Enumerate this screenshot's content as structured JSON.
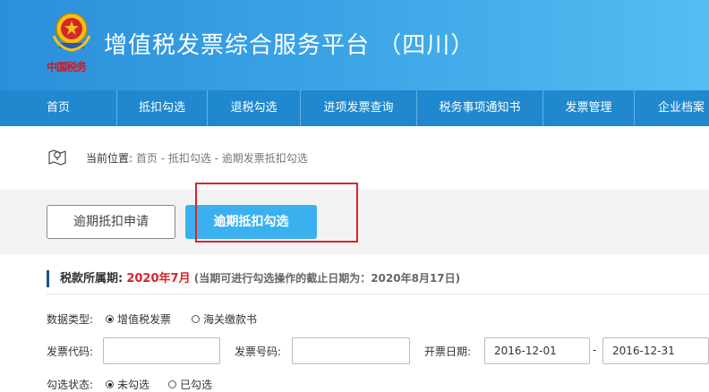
{
  "header": {
    "brand_text": "中国税务",
    "app_title": "增值税发票综合服务平台 （四川）"
  },
  "nav": {
    "items": [
      "首页",
      "抵扣勾选",
      "退税勾选",
      "进项发票查询",
      "税务事项通知书",
      "发票管理",
      "企业档案"
    ]
  },
  "breadcrumb": {
    "prefix": "当前位置:",
    "path": "首页 - 抵扣勾选 - 逾期发票抵扣勾选"
  },
  "tabs": {
    "inactive_label": "逾期抵扣申请",
    "active_label": "逾期抵扣勾选"
  },
  "period": {
    "label": "税款所属期:",
    "value": "2020年7月",
    "note": "(当期可进行勾选操作的截止日期为：2020年8月17日)"
  },
  "form": {
    "data_type_label": "数据类型:",
    "data_type_options": [
      "增值税发票",
      "海关缴款书"
    ],
    "data_type_selected": "增值税发票",
    "invoice_code_label": "发票代码:",
    "invoice_code_value": "",
    "invoice_number_label": "发票号码:",
    "invoice_number_value": "",
    "issue_date_label": "开票日期:",
    "date_from": "2016-12-01",
    "date_separator": "-",
    "date_to": "2016-12-31",
    "check_status_label": "勾选状态:",
    "check_status_options": [
      "未勾选",
      "已勾选"
    ],
    "check_status_selected": "未勾选"
  },
  "colors": {
    "header_blue": "#2b8fd9",
    "nav_blue": "#1f88cf",
    "active_tab": "#3ab0ef",
    "highlight_red": "#d9242b"
  },
  "icons": {
    "emblem": "tax-emblem-icon",
    "location": "map-pin-icon"
  }
}
